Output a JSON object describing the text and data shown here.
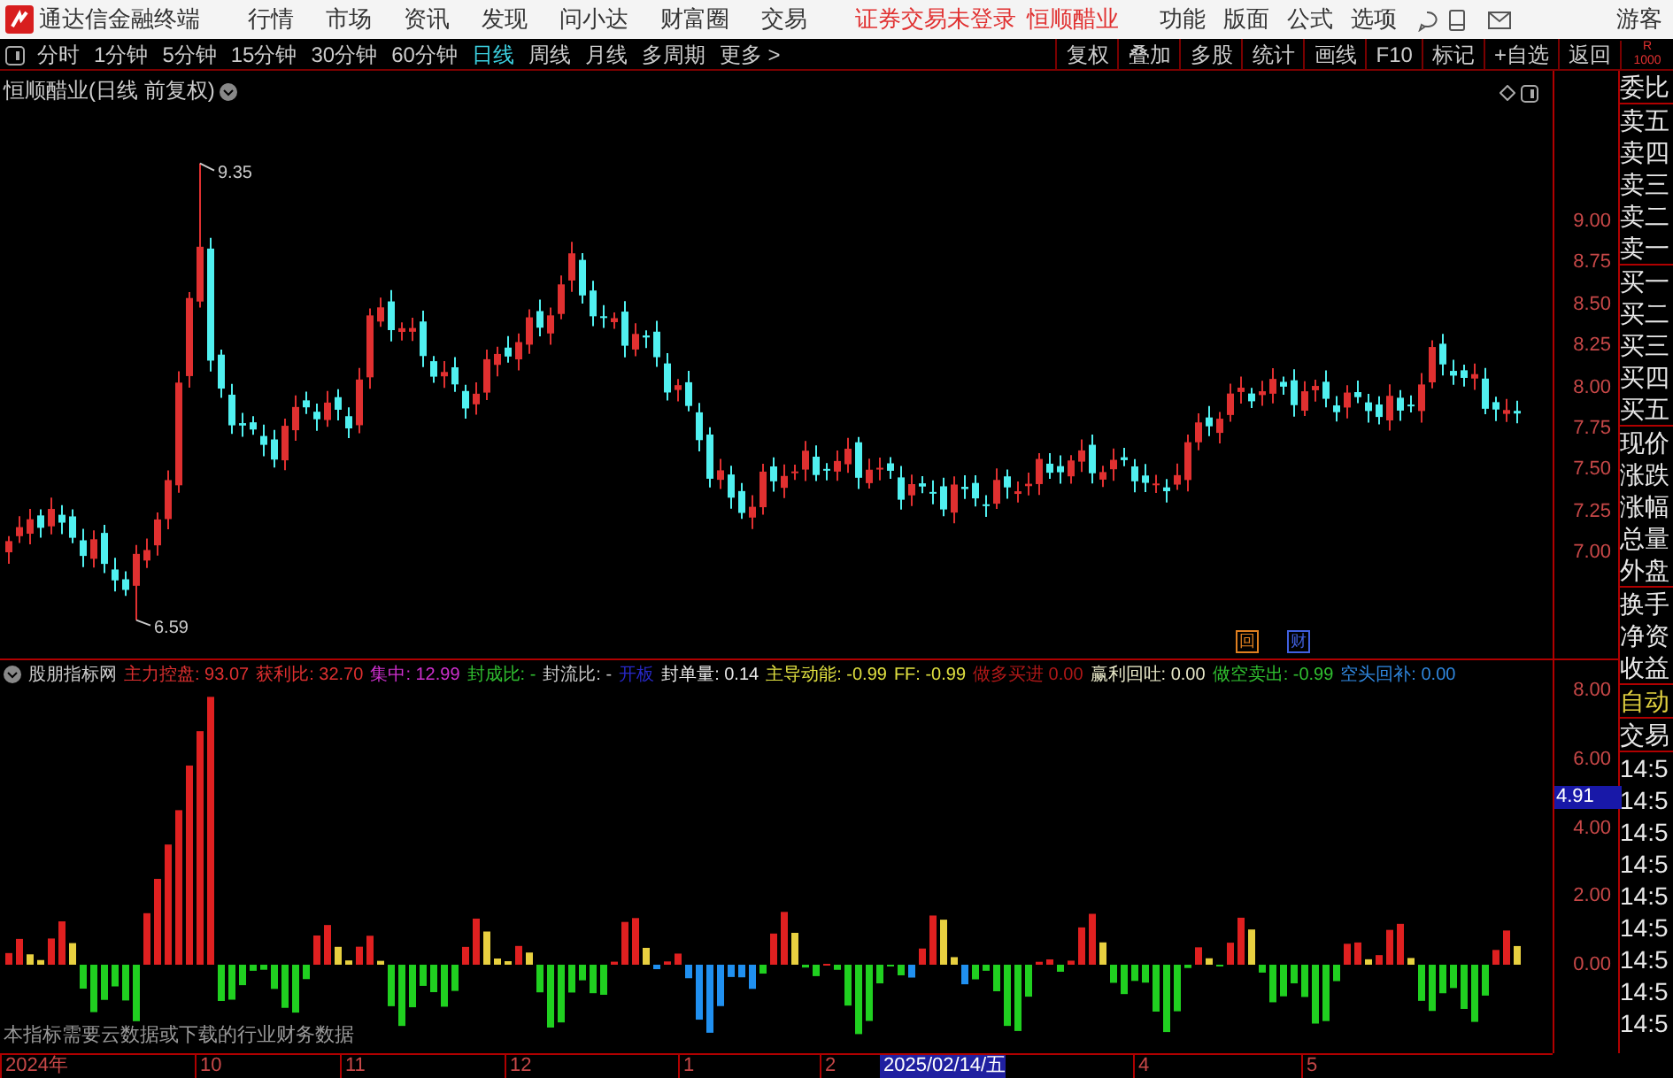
{
  "app": {
    "title": "通达信金融终端",
    "menu": [
      "行情",
      "市场",
      "资讯",
      "发现",
      "问小达",
      "财富圈",
      "交易"
    ],
    "login_status": "证券交易未登录",
    "stock_name": "恒顺醋业",
    "right_menu": [
      "功能",
      "版面",
      "公式",
      "选项"
    ],
    "user": "游客"
  },
  "periods": [
    {
      "label": "分时",
      "selected": false
    },
    {
      "label": "1分钟",
      "selected": false
    },
    {
      "label": "5分钟",
      "selected": false
    },
    {
      "label": "15分钟",
      "selected": false
    },
    {
      "label": "30分钟",
      "selected": false
    },
    {
      "label": "60分钟",
      "selected": false
    },
    {
      "label": "日线",
      "selected": true
    },
    {
      "label": "周线",
      "selected": false
    },
    {
      "label": "月线",
      "selected": false
    },
    {
      "label": "多周期",
      "selected": false
    },
    {
      "label": "更多 >",
      "selected": false
    }
  ],
  "tools": [
    "复权",
    "叠加",
    "多股",
    "统计",
    "画线",
    "F10",
    "标记",
    "+自选",
    "返回"
  ],
  "corner": [
    "R",
    "1000"
  ],
  "price_chart": {
    "title": "恒顺醋业(日线 前复权)",
    "high_label": "9.35",
    "low_label": "6.59",
    "axis": [
      "9.00",
      "8.75",
      "8.50",
      "8.25",
      "8.00",
      "7.75",
      "7.50",
      "7.25",
      "7.00"
    ],
    "markers": [
      {
        "label": "回",
        "color": "#e08020"
      },
      {
        "label": "财",
        "color": "#4060e0"
      }
    ]
  },
  "indicator": {
    "name": "股朋指标网",
    "stats": [
      {
        "label": "主力控盘:",
        "value": "93.07",
        "color": "#e03030"
      },
      {
        "label": "获利比:",
        "value": "32.70",
        "color": "#e03030"
      },
      {
        "label": "集中:",
        "value": "12.99",
        "color": "#d030d0"
      },
      {
        "label": "封成比:",
        "value": "-",
        "color": "#30c030"
      },
      {
        "label": "封流比:",
        "value": "-",
        "color": "#c8c8c8"
      },
      {
        "label": "开板",
        "color": "#2828c8"
      },
      {
        "label": "封单量:",
        "value": "0.14",
        "color": "#e8e8e8"
      },
      {
        "label": "主导动能:",
        "value": "-0.99",
        "color": "#e0e040"
      },
      {
        "label": "FF:",
        "value": "-0.99",
        "color": "#e0e040"
      },
      {
        "label": "做多买进",
        "value": "0.00",
        "color": "#b01818"
      },
      {
        "label": "赢利回吐:",
        "value": "0.00",
        "color": "#e8e8c8"
      },
      {
        "label": "做空卖出:",
        "value": "-0.99",
        "color": "#30c030"
      },
      {
        "label": "空头回补:",
        "value": "0.00",
        "color": "#3088e0"
      }
    ],
    "axis": [
      "8.00",
      "6.00",
      "4.00",
      "2.00",
      "0.00"
    ],
    "cursor_value": "4.91",
    "note": "本指标需要云数据或下载的行业财务数据"
  },
  "date_axis": [
    {
      "label": "2024年",
      "highlighted": false
    },
    {
      "label": "10",
      "highlighted": false
    },
    {
      "label": "11",
      "highlighted": false
    },
    {
      "label": "12",
      "highlighted": false
    },
    {
      "label": "1",
      "highlighted": false
    },
    {
      "label": "2",
      "highlighted": false
    },
    {
      "label": "2025/02/14/五",
      "highlighted": true
    },
    {
      "label": "4",
      "highlighted": false
    },
    {
      "label": "5",
      "highlighted": false
    }
  ],
  "quote_panel": {
    "groups": [
      [
        "委比"
      ],
      [
        "卖五",
        "卖四",
        "卖三",
        "卖二",
        "卖一"
      ],
      [
        "买一",
        "买二",
        "买三",
        "买四",
        "买五"
      ],
      [
        "现价",
        "涨跌",
        "涨幅",
        "总量",
        "外盘"
      ],
      [
        "换手",
        "净资",
        "收益"
      ]
    ],
    "mode": "自动",
    "trade": "交易",
    "times": [
      "14:5",
      "14:5",
      "14:5",
      "14:5",
      "14:5",
      "14:5",
      "14:5",
      "14:5",
      "14:5"
    ]
  }
}
